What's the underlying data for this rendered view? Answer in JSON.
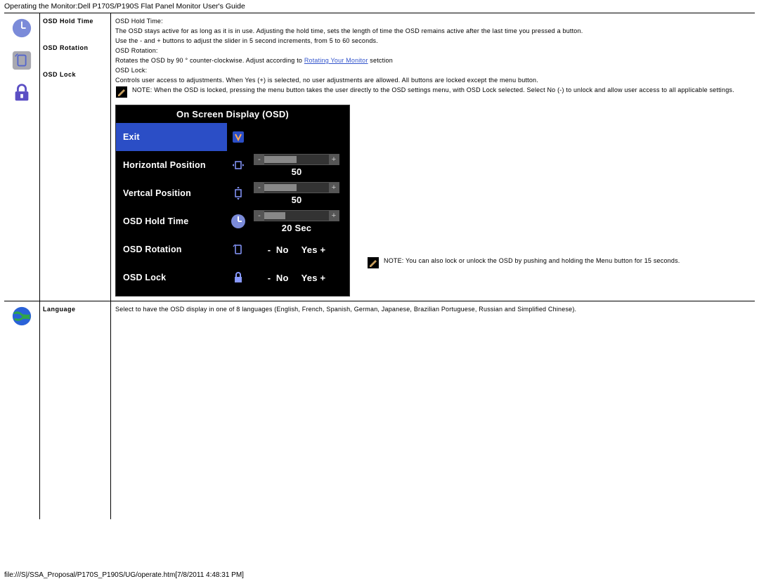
{
  "header": "Operating the Monitor:Dell P170S/P190S Flat Panel Monitor User's Guide",
  "footer": "file:///S|/SSA_Proposal/P170S_P190S/UG/operate.htm[7/8/2011 4:48:31 PM]",
  "section1": {
    "labels": {
      "hold": "OSD Hold Time",
      "rotation": "OSD Rotation",
      "lock": "OSD Lock"
    },
    "hold_title": "OSD Hold Time:",
    "hold_body1": "The OSD stays active for as long as it is in use. Adjusting the hold time, sets the length of time the OSD remains active after the last time you pressed a button.",
    "hold_body2": "Use the - and + buttons to adjust the slider in 5 second increments, from 5 to 60 seconds.",
    "rotation_title": "OSD Rotation:",
    "rotation_body_pre": "Rotates the OSD by 90 ° counter-clockwise. Adjust according to ",
    "rotation_link": "Rotating Your Monitor",
    "rotation_body_post": " setction",
    "lock_title": "OSD Lock:",
    "lock_body": "Controls user access to adjustments. When Yes (+) is selected, no user adjustments are allowed. All buttons are locked except the menu button.",
    "note1_prefix": "NOTE:",
    "note1_body": " When the OSD is locked, pressing the menu button takes the user directly to the OSD settings menu, with OSD Lock selected. Select No (-) to unlock and allow user access to all applicable settings.",
    "note2_prefix": "NOTE:",
    "note2_body": " You can also lock or unlock the OSD by pushing and holding the Menu button for 15 seconds."
  },
  "osd": {
    "title": "On Screen Display (OSD)",
    "exit": "Exit",
    "hpos": "Horizontal Position",
    "vpos": "Vertcal Position",
    "hold": "OSD Hold Time",
    "rotation": "OSD Rotation",
    "lock": "OSD Lock",
    "val50": "50",
    "val50b": "50",
    "val20": "20 Sec",
    "no": "No",
    "yes": "Yes +",
    "minus": "-"
  },
  "section2": {
    "label": "Language",
    "body": "Select to have the OSD display in one of 8 languages (English, French, Spanish, German, Japanese, Brazilian Portuguese, Russian and Simplified Chinese)."
  }
}
